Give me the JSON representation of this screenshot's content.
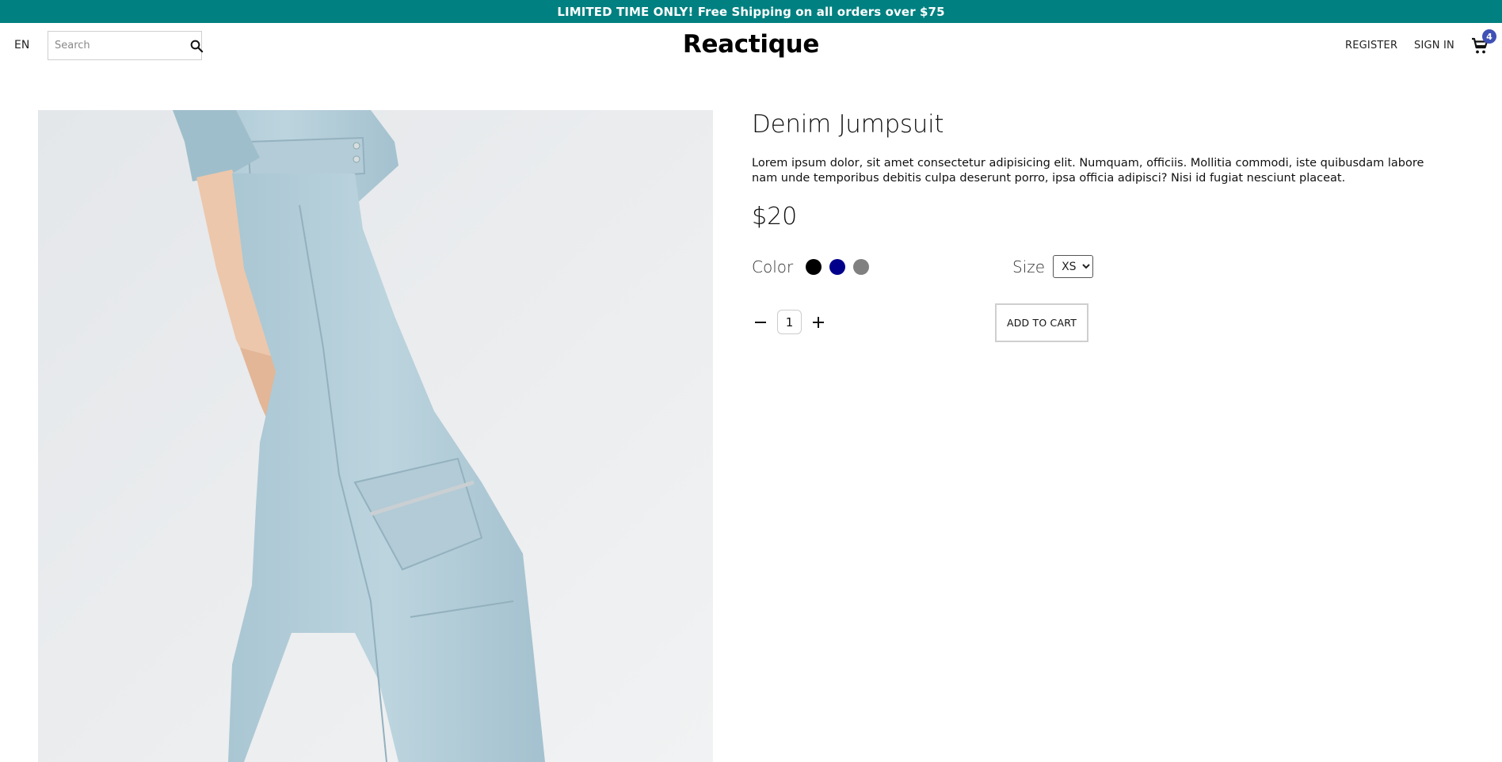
{
  "banner": {
    "text": "LIMITED TIME ONLY! Free Shipping on all orders over $75"
  },
  "nav": {
    "language": "EN",
    "search_placeholder": "Search",
    "brand": "Reactique",
    "register_label": "REGISTER",
    "signin_label": "SIGN IN",
    "cart_count": "4"
  },
  "product": {
    "title": "Denim Jumpsuit",
    "description": "Lorem ipsum dolor, sit amet consectetur adipisicing elit. Numquam, officiis. Mollitia commodi, iste quibusdam labore nam unde temporibus debitis culpa deserunt porro, ipsa officia adipisci? Nisi id fugiat nesciunt placeat.",
    "price": "$20",
    "color_label": "Color",
    "colors": [
      "#000000",
      "#00008b",
      "#808080"
    ],
    "size_label": "Size",
    "size_selected": "XS",
    "quantity": "1",
    "add_to_cart_label": "ADD TO CART"
  },
  "colors": {
    "banner": "#008080",
    "badge": "#3f51b5"
  }
}
